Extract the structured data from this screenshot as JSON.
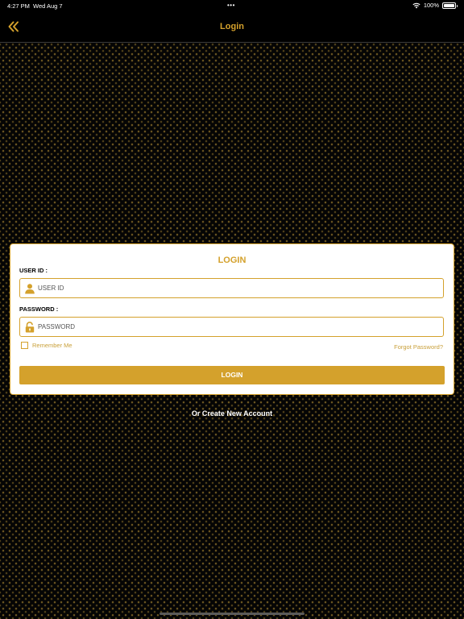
{
  "status_bar": {
    "time": "4:27 PM",
    "date": "Wed Aug 7",
    "dots": "•••",
    "battery": "100%"
  },
  "nav": {
    "title": "Login",
    "back_icon": "double-chevron-left-icon"
  },
  "form": {
    "title": "LOGIN",
    "user_id_label": "USER ID :",
    "user_id_placeholder": "USER ID",
    "password_label": "PASSWORD :",
    "password_placeholder": "PASSWORD",
    "remember_label": "Remember Me",
    "forgot_label": "Forgot Password?",
    "login_button": "LOGIN"
  },
  "create_account": "Or Create New Account",
  "colors": {
    "accent": "#d4a12c",
    "background": "#050505",
    "card": "#ffffff"
  }
}
